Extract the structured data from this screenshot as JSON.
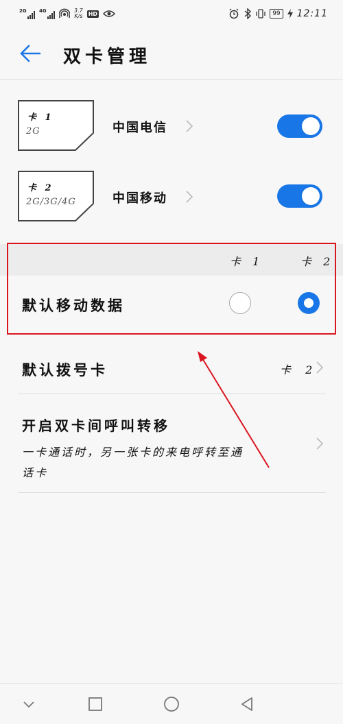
{
  "status_bar": {
    "sim1_network": "2G",
    "sim2_network": "4G",
    "speed_value": "3.7",
    "speed_unit": "K/s",
    "hd_badge": "HD",
    "battery": "99",
    "time": "12:11"
  },
  "header": {
    "title": "双卡管理"
  },
  "sims": [
    {
      "card_label": "卡 1",
      "network": "2G",
      "carrier": "中国电信",
      "enabled": true
    },
    {
      "card_label": "卡 2",
      "network": "2G/3G/4G",
      "carrier": "中国移动",
      "enabled": true
    }
  ],
  "default_data": {
    "col_sim1": "卡 1",
    "col_sim2": "卡 2",
    "label": "默认移动数据",
    "selected": "卡 2"
  },
  "default_dial": {
    "label": "默认拨号卡",
    "value": "卡 2"
  },
  "call_forwarding": {
    "label": "开启双卡间呼叫转移",
    "description": "一卡通话时，另一张卡的来电呼转至通话卡"
  },
  "colors": {
    "accent": "#1976e6",
    "annotation": "#d9161f"
  }
}
